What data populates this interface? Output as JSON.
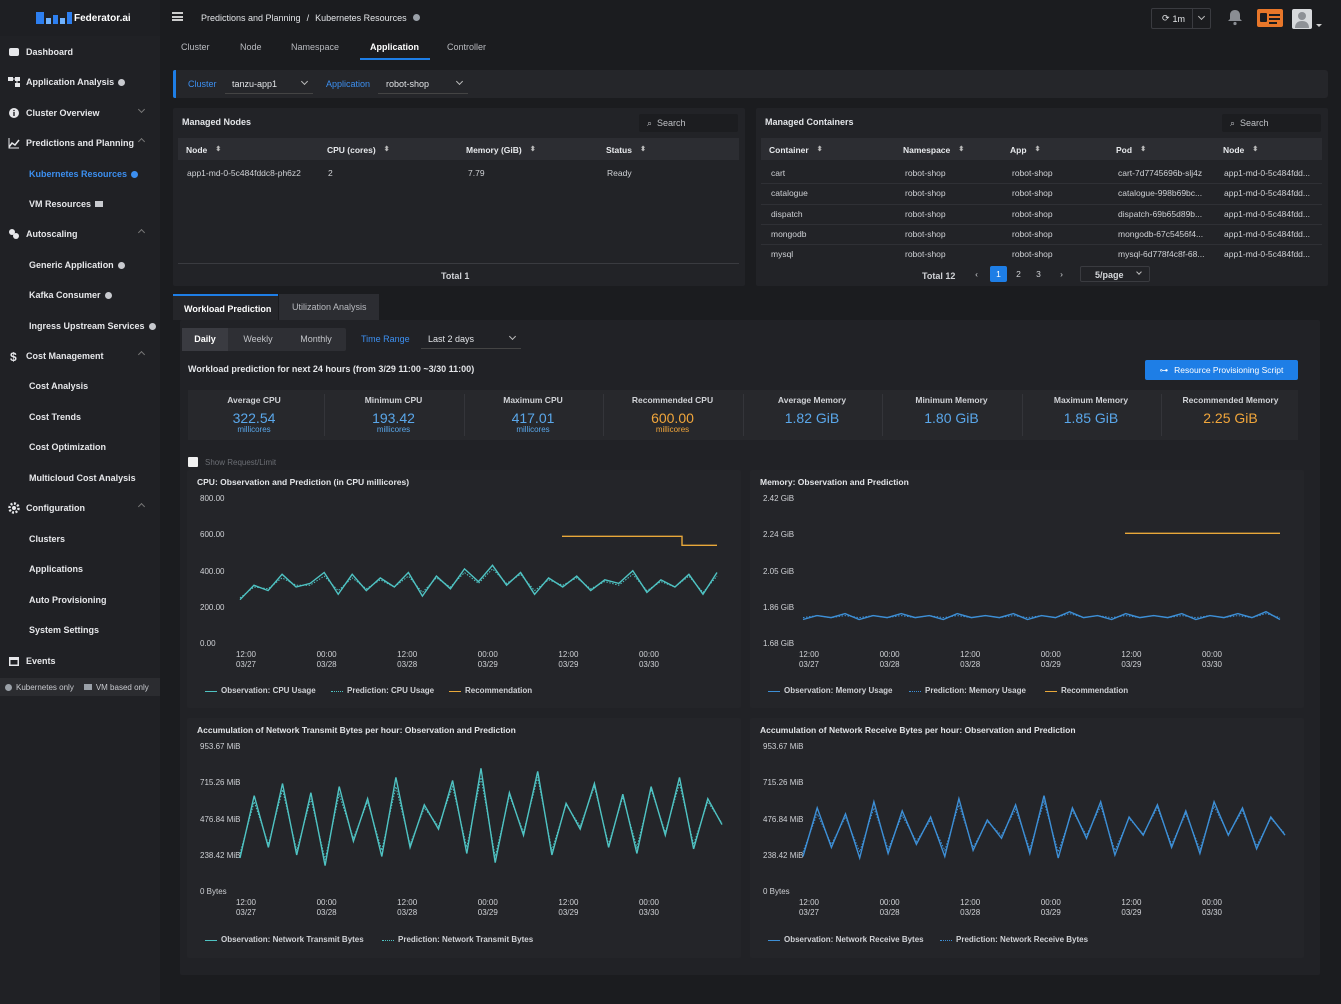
{
  "app": {
    "name": "Federator.ai"
  },
  "sidebar": {
    "items": [
      {
        "label": "Dashboard",
        "icon": "dashboard-icon"
      },
      {
        "label": "Application Analysis",
        "icon": "app-analysis-icon"
      },
      {
        "label": "Cluster Overview",
        "icon": "info-icon"
      },
      {
        "label": "Predictions and Planning",
        "icon": "chart-line-icon"
      },
      {
        "label": "Kubernetes Resources",
        "sub": true
      },
      {
        "label": "VM Resources",
        "sub": true
      },
      {
        "label": "Autoscaling",
        "icon": "autoscaling-icon"
      },
      {
        "label": "Generic Application",
        "sub": true
      },
      {
        "label": "Kafka Consumer",
        "sub": true
      },
      {
        "label": "Ingress Upstream Services",
        "sub": true
      },
      {
        "label": "Cost Management",
        "icon": "dollar-icon"
      },
      {
        "label": "Cost Analysis",
        "sub": true
      },
      {
        "label": "Cost Trends",
        "sub": true
      },
      {
        "label": "Cost Optimization",
        "sub": true
      },
      {
        "label": "Multicloud Cost Analysis",
        "sub": true
      },
      {
        "label": "Configuration",
        "icon": "gear-icon"
      },
      {
        "label": "Clusters",
        "sub": true
      },
      {
        "label": "Applications",
        "sub": true
      },
      {
        "label": "Auto Provisioning",
        "sub": true
      },
      {
        "label": "System Settings",
        "sub": true
      },
      {
        "label": "Events",
        "icon": "calendar-icon"
      }
    ],
    "legend_k8s": "Kubernetes only",
    "legend_vm": "VM based only"
  },
  "header": {
    "breadcrumb_1": "Predictions and Planning",
    "breadcrumb_sep": "/",
    "breadcrumb_2": "Kubernetes Resources",
    "refresh": "1m"
  },
  "tabs": [
    "Cluster",
    "Node",
    "Namespace",
    "Application",
    "Controller"
  ],
  "filters": {
    "cluster_label": "Cluster",
    "cluster_value": "tanzu-app1",
    "app_label": "Application",
    "app_value": "robot-shop"
  },
  "nodes_panel": {
    "title": "Managed Nodes",
    "search": "Search",
    "headers": [
      "Node",
      "CPU (cores)",
      "Memory (GiB)",
      "Status"
    ],
    "rows": [
      [
        "app1-md-0-5c484fddc8-ph6z2",
        "2",
        "7.79",
        "Ready"
      ]
    ],
    "total": "Total 1"
  },
  "containers_panel": {
    "title": "Managed Containers",
    "search": "Search",
    "headers": [
      "Container",
      "Namespace",
      "App",
      "Pod",
      "Node"
    ],
    "rows": [
      [
        "cart",
        "robot-shop",
        "robot-shop",
        "cart-7d7745696b-slj4z",
        "app1-md-0-5c484fdd..."
      ],
      [
        "catalogue",
        "robot-shop",
        "robot-shop",
        "catalogue-998b69bc...",
        "app1-md-0-5c484fdd..."
      ],
      [
        "dispatch",
        "robot-shop",
        "robot-shop",
        "dispatch-69b65d89b...",
        "app1-md-0-5c484fdd..."
      ],
      [
        "mongodb",
        "robot-shop",
        "robot-shop",
        "mongodb-67c5456f4...",
        "app1-md-0-5c484fdd..."
      ],
      [
        "mysql",
        "robot-shop",
        "robot-shop",
        "mysql-6d778f4c8f-68...",
        "app1-md-0-5c484fdd..."
      ]
    ],
    "total": "Total 12",
    "pages": [
      "1",
      "2",
      "3"
    ],
    "page_size": "5/page"
  },
  "workload": {
    "tab_1": "Workload Prediction",
    "tab_2": "Utilization Analysis",
    "periods": [
      "Daily",
      "Weekly",
      "Monthly"
    ],
    "time_range_label": "Time Range",
    "time_range_value": "Last 2 days",
    "caption": "Workload prediction for next 24 hours (from 3/29 11:00 ~3/30 11:00)",
    "script_button": "Resource Provisioning Script",
    "show_request": "Show Request/Limit",
    "metrics": [
      {
        "label": "Average CPU",
        "value": "322.54",
        "unit": "millicores"
      },
      {
        "label": "Minimum CPU",
        "value": "193.42",
        "unit": "millicores"
      },
      {
        "label": "Maximum CPU",
        "value": "417.01",
        "unit": "millicores"
      },
      {
        "label": "Recommended CPU",
        "value": "600.00",
        "unit": "millicores",
        "rec": true
      },
      {
        "label": "Average Memory",
        "value": "1.82 GiB",
        "unit": ""
      },
      {
        "label": "Minimum Memory",
        "value": "1.80 GiB",
        "unit": ""
      },
      {
        "label": "Maximum Memory",
        "value": "1.85 GiB",
        "unit": ""
      },
      {
        "label": "Recommended Memory",
        "value": "2.25 GiB",
        "unit": "",
        "rec": true
      }
    ]
  },
  "colors": {
    "teal": "#4fc3c3",
    "blue": "#3d8fd6",
    "orange": "#e8a83a",
    "accent": "#1e7ee6"
  },
  "x_ticks": [
    [
      "12:00",
      "03/27"
    ],
    [
      "00:00",
      "03/28"
    ],
    [
      "12:00",
      "03/28"
    ],
    [
      "00:00",
      "03/29"
    ],
    [
      "12:00",
      "03/29"
    ],
    [
      "00:00",
      "03/30"
    ]
  ],
  "chart_data": [
    {
      "type": "line",
      "title": "CPU: Observation and Prediction (in CPU millicores)",
      "y_ticks": [
        "800.00",
        "600.00",
        "400.00",
        "200.00",
        "0.00"
      ],
      "ylim": [
        0,
        800
      ],
      "series": [
        {
          "name": "Observation: CPU Usage",
          "style": "solid",
          "values": [
            250,
            330,
            300,
            390,
            320,
            340,
            400,
            280,
            390,
            300,
            370,
            320,
            400,
            270,
            380,
            310,
            420,
            350,
            440,
            330,
            400,
            280,
            370,
            320,
            380,
            300,
            360,
            340,
            410,
            290,
            360,
            320,
            390,
            280,
            400
          ]
        },
        {
          "name": "Prediction: CPU Usage",
          "style": "dotted",
          "values": [
            260,
            320,
            310,
            370,
            330,
            330,
            380,
            300,
            370,
            310,
            360,
            320,
            380,
            290,
            370,
            320,
            400,
            340,
            420,
            340,
            390,
            300,
            360,
            330,
            370,
            310,
            350,
            330,
            390,
            300,
            350,
            320,
            380,
            290,
            380
          ]
        },
        {
          "name": "Recommendation",
          "style": "step",
          "values": [
            600,
            600,
            600,
            600,
            550,
            550
          ]
        }
      ]
    },
    {
      "type": "line",
      "title": "Memory: Observation and Prediction",
      "y_ticks": [
        "2.42 GiB",
        "2.24 GiB",
        "2.05 GiB",
        "1.86 GiB",
        "1.68 GiB"
      ],
      "ylim": [
        1.68,
        2.42
      ],
      "series": [
        {
          "name": "Observation: Memory Usage",
          "style": "solid",
          "values": [
            1.81,
            1.83,
            1.82,
            1.84,
            1.81,
            1.83,
            1.82,
            1.84,
            1.82,
            1.83,
            1.81,
            1.84,
            1.82,
            1.83,
            1.82,
            1.84,
            1.81,
            1.83,
            1.82,
            1.85,
            1.82,
            1.83,
            1.81,
            1.84,
            1.82,
            1.83,
            1.82,
            1.84,
            1.81,
            1.83,
            1.82,
            1.84,
            1.82,
            1.85,
            1.81
          ]
        },
        {
          "name": "Prediction: Memory Usage",
          "style": "dotted",
          "values": [
            1.82,
            1.83,
            1.82,
            1.83,
            1.82,
            1.83,
            1.82,
            1.83,
            1.82,
            1.83,
            1.82,
            1.83,
            1.82,
            1.83,
            1.82,
            1.83,
            1.82,
            1.83,
            1.82,
            1.84,
            1.82,
            1.83,
            1.82,
            1.83,
            1.82,
            1.83,
            1.82,
            1.83,
            1.82,
            1.83,
            1.82,
            1.83,
            1.82,
            1.84,
            1.82
          ]
        },
        {
          "name": "Recommendation",
          "style": "step",
          "values": [
            2.25,
            2.25
          ]
        }
      ]
    },
    {
      "type": "line",
      "title": "Accumulation of Network Transmit Bytes per hour: Observation and Prediction",
      "y_ticks": [
        "953.67 MiB",
        "715.26 MiB",
        "476.84 MiB",
        "238.42 MiB",
        "0 Bytes"
      ],
      "ylim": [
        0,
        953.67
      ],
      "series": [
        {
          "name": "Observation: Network Transmit Bytes",
          "style": "solid",
          "values": [
            230,
            640,
            300,
            720,
            250,
            660,
            180,
            700,
            340,
            620,
            240,
            760,
            300,
            580,
            420,
            740,
            260,
            820,
            200,
            660,
            380,
            800,
            250,
            590,
            420,
            720,
            300,
            650,
            260,
            700,
            380,
            760,
            290,
            620,
            450
          ]
        },
        {
          "name": "Prediction: Network Transmit Bytes",
          "style": "dotted",
          "values": [
            260,
            600,
            320,
            680,
            280,
            620,
            220,
            650,
            360,
            600,
            280,
            700,
            320,
            560,
            440,
            700,
            300,
            760,
            240,
            640,
            400,
            760,
            280,
            580,
            440,
            700,
            320,
            630,
            300,
            680,
            400,
            720,
            320,
            600,
            460
          ]
        }
      ]
    },
    {
      "type": "line",
      "title": "Accumulation of Network Receive Bytes per hour: Observation and Prediction",
      "y_ticks": [
        "953.67 MiB",
        "715.26 MiB",
        "476.84 MiB",
        "238.42 MiB",
        "0 Bytes"
      ],
      "ylim": [
        0,
        953.67
      ],
      "series": [
        {
          "name": "Observation: Network Receive Bytes",
          "style": "solid",
          "values": [
            240,
            560,
            300,
            520,
            230,
            600,
            260,
            540,
            320,
            500,
            240,
            620,
            280,
            480,
            360,
            580,
            260,
            640,
            230,
            560,
            360,
            600,
            250,
            500,
            380,
            580,
            300,
            540,
            260,
            600,
            380,
            560,
            290,
            500,
            380
          ]
        },
        {
          "name": "Prediction: Network Receive Bytes",
          "style": "dotted",
          "values": [
            270,
            520,
            320,
            500,
            270,
            560,
            290,
            510,
            340,
            480,
            280,
            580,
            300,
            470,
            380,
            550,
            290,
            600,
            270,
            540,
            380,
            570,
            280,
            490,
            390,
            560,
            320,
            520,
            290,
            570,
            390,
            540,
            310,
            490,
            390
          ]
        }
      ]
    }
  ]
}
